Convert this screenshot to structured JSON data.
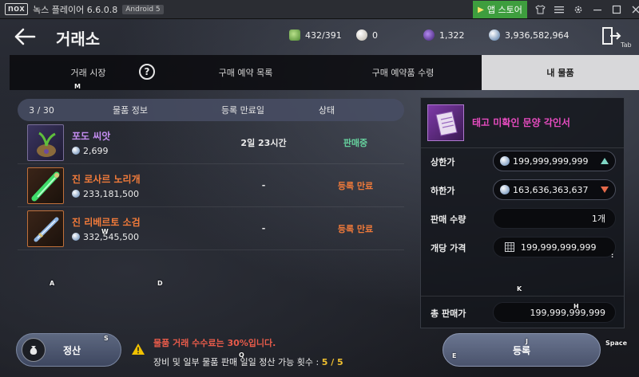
{
  "emulator": {
    "logo": "nox",
    "title": "녹스 플레이어 6.6.0.8",
    "badge": "Android 5",
    "store_label": "앱 스토어",
    "icons": [
      "shirt-icon",
      "menu-icon",
      "gear-icon",
      "minimize-icon",
      "maximize-icon",
      "close-icon"
    ]
  },
  "header": {
    "title": "거래소",
    "currencies": [
      {
        "icon": "energy-icon",
        "value": "432/391",
        "color": "#6fae58"
      },
      {
        "icon": "pearl-icon",
        "value": "0",
        "color": "#d8d2c8"
      },
      {
        "icon": "purple-gem-icon",
        "value": "1,322",
        "color": "#6b3fa8"
      },
      {
        "icon": "silver-icon",
        "value": "3,936,582,964",
        "color": "#9ab3d0"
      }
    ],
    "exit_key": "Tab"
  },
  "tabs": [
    {
      "label": "거래 시장",
      "active": false
    },
    {
      "label": "구매 예약 목록",
      "active": false
    },
    {
      "label": "구매 예약품 수령",
      "active": false
    },
    {
      "label": "내 물품",
      "active": true
    }
  ],
  "table": {
    "count": "3 / 30",
    "columns": [
      "물품 정보",
      "등록 만료일",
      "상태"
    ],
    "rows": [
      {
        "name": "포도 씨앗",
        "name_color": "#c38cf0",
        "price": "2,699",
        "expiry": "2일 23시간",
        "status": "판매중",
        "status_color": "#66d19e",
        "icon": "grape-seed-icon"
      },
      {
        "name": "진 로사르 노리개",
        "name_color": "#f07a3a",
        "price": "233,181,500",
        "expiry": "-",
        "status": "등록 만료",
        "status_color": "#f07a3a",
        "icon": "green-talisman-icon"
      },
      {
        "name": "진 리베르토 소검",
        "name_color": "#f07a3a",
        "price": "332,545,500",
        "expiry": "-",
        "status": "등록 만료",
        "status_color": "#f07a3a",
        "icon": "blue-dagger-icon"
      }
    ]
  },
  "detail": {
    "item_name": "태고 미확인 문양 각인서",
    "item_icon": "engraving-book-icon",
    "max_price_label": "상한가",
    "max_price": "199,999,999,999",
    "min_price_label": "하한가",
    "min_price": "163,636,363,637",
    "qty_label": "판매 수량",
    "qty": "1개",
    "unit_price_label": "개당 가격",
    "unit_price": "199,999,999,999",
    "total_label": "총 판매가",
    "total": "199,999,999,999"
  },
  "footer": {
    "settle_label": "정산",
    "notice_fee": "물품 거래 수수료는 30%입니다.",
    "notice_settle_prefix": "장비 및 일부 물품 판매 일일 정산 가능 횟수 : ",
    "notice_settle_count": "5 / 5",
    "register_label": "등록"
  },
  "key_hints": {
    "m": "M",
    "w": "W",
    "a": "A",
    "d": "D",
    "k": "K",
    "h": "H",
    "s": "S",
    "q": "Q",
    "e": "E",
    "j": "J",
    "space": "Space",
    "colon": ":"
  }
}
